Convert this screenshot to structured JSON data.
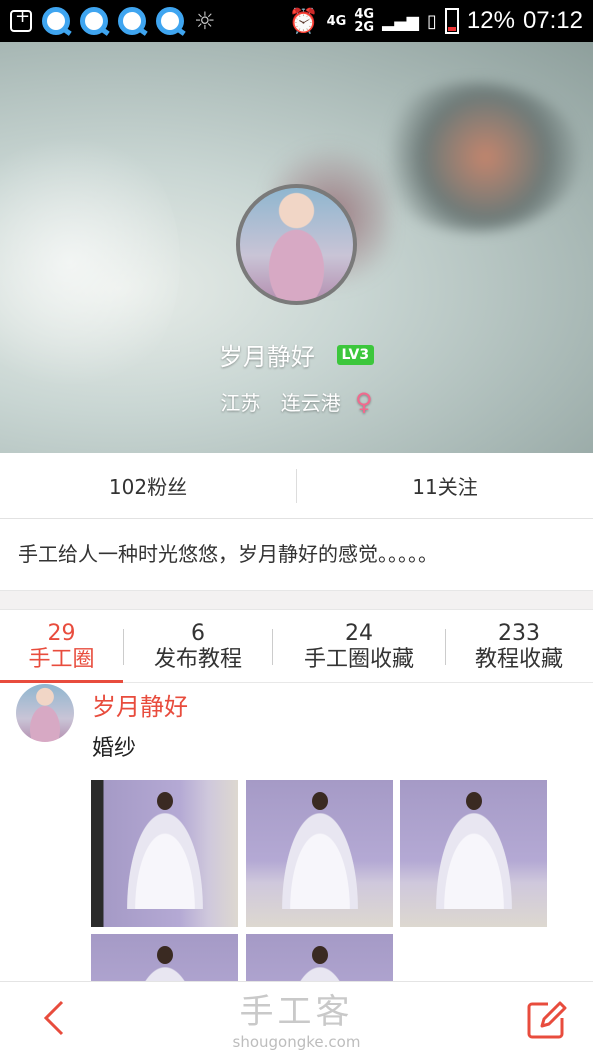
{
  "status_bar": {
    "network1": "4G",
    "network2_top": "4G",
    "network2_bottom": "2G",
    "battery": "12%",
    "time": "07:12"
  },
  "profile": {
    "username": "岁月静好",
    "level": "LV3",
    "province": "江苏",
    "city": "连云港",
    "gender_symbol": "♀",
    "gender_color": "#f06a8e"
  },
  "stats": {
    "followers": "102粉丝",
    "following": "11关注"
  },
  "bio": "手工给人一种时光悠悠，岁月静好的感觉。。。。。",
  "tabs": [
    {
      "count": "29",
      "label": "手工圈",
      "active": true
    },
    {
      "count": "6",
      "label": "发布教程",
      "active": false
    },
    {
      "count": "24",
      "label": "手工圈收藏",
      "active": false
    },
    {
      "count": "233",
      "label": "教程收藏",
      "active": false
    }
  ],
  "post": {
    "author": "岁月静好",
    "title": "婚纱"
  },
  "watermark": {
    "cn": "手工客",
    "url": "shougongke.com"
  },
  "colors": {
    "accent": "#e84c3d",
    "level_badge": "#3cc73c"
  },
  "icons": {
    "back": "chevron-left-icon",
    "edit": "edit-icon"
  }
}
